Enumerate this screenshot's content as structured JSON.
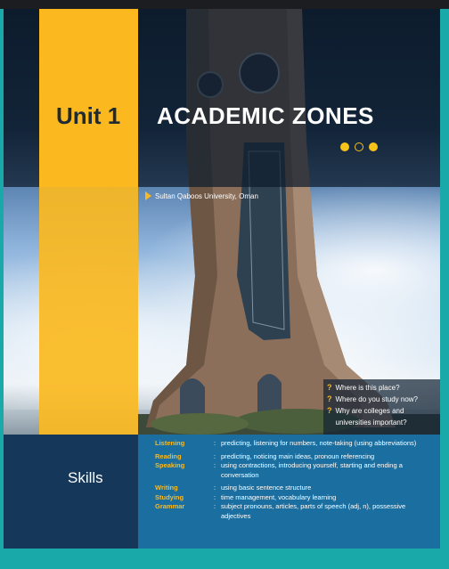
{
  "unit": {
    "label": "Unit 1",
    "title": "ACADEMIC ZONES"
  },
  "photo": {
    "caption": "Sultan Qaboos University, Oman"
  },
  "questions": [
    "Where is this place?",
    "Where do you study now?",
    "Why are colleges and universities important?"
  ],
  "skills": {
    "title": "Skills",
    "items": [
      {
        "name": "Listening",
        "desc": "predicting, listening for numbers, note-taking (using abbreviations)"
      },
      {
        "name": "Reading",
        "desc": "predicting, noticing main ideas, pronoun referencing"
      },
      {
        "name": "Speaking",
        "desc": "using contractions, introducing yourself, starting and ending a conversation"
      },
      {
        "name": "Writing",
        "desc": "using basic sentence structure"
      },
      {
        "name": "Studying",
        "desc": "time management, vocabulary learning"
      },
      {
        "name": "Grammar",
        "desc": "subject pronouns, articles, parts of speech (adj, n), possessive adjectives"
      }
    ]
  },
  "colors": {
    "accent": "#fbb91f",
    "navy": "#15375a",
    "blue": "#1a6fa0",
    "teal": "#19a9a9"
  }
}
